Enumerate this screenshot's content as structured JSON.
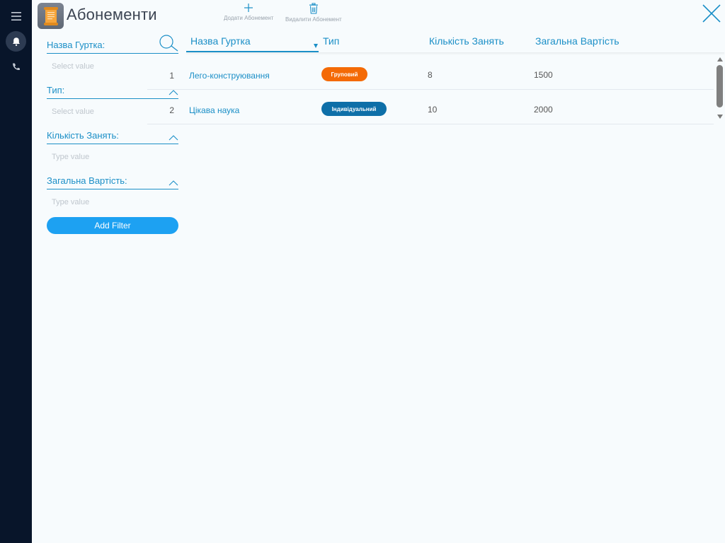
{
  "header": {
    "title": "Абонементи",
    "add_label": "Додати Абонемент",
    "delete_label": "Видалити Абонемент"
  },
  "filters": {
    "items": [
      {
        "label": "Назва Гуртка:",
        "placeholder": "Select value"
      },
      {
        "label": "Тип:",
        "placeholder": "Select value"
      },
      {
        "label": "Кількість Занять:",
        "placeholder": "Type value"
      },
      {
        "label": "Загальна Вартість:",
        "placeholder": "Type value"
      }
    ],
    "add_filter_label": "Add Filter"
  },
  "table": {
    "columns": [
      "Назва Гуртка",
      "Тип",
      "Кількість Занять",
      "Загальна Вартість"
    ],
    "rows": [
      {
        "num": "1",
        "name": "Лего-конструювання",
        "type": "Груповий",
        "count": "8",
        "cost": "1500"
      },
      {
        "num": "2",
        "name": "Цікава наука",
        "type": "Індивідуальний",
        "count": "10",
        "cost": "2000"
      }
    ]
  },
  "colors": {
    "accent": "#1b8fc7",
    "rail": "#08152a",
    "badge_group": "#f46a06",
    "badge_individual": "#0e6fa8",
    "button": "#1da1f2"
  },
  "icons": {
    "rail": [
      "menu-icon",
      "bell-icon",
      "phone-icon"
    ],
    "header": [
      "scroll-document-icon",
      "plus-icon",
      "trash-icon",
      "close-icon"
    ],
    "filters": [
      "search-icon",
      "chevron-up-icon"
    ]
  }
}
